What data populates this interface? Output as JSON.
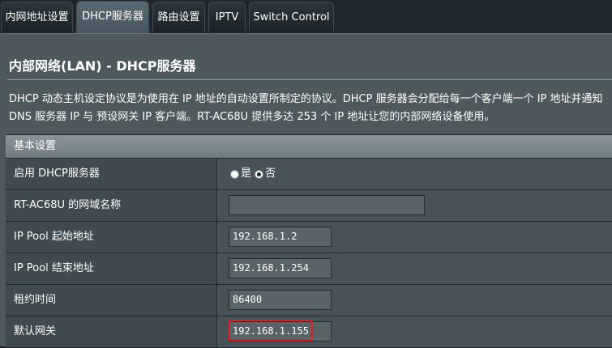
{
  "tabs": [
    {
      "label": "内网地址设置",
      "active": false
    },
    {
      "label": "DHCP服务器",
      "active": true
    },
    {
      "label": "路由设置",
      "active": false
    },
    {
      "label": "IPTV",
      "active": false
    },
    {
      "label": "Switch Control",
      "active": false
    }
  ],
  "page": {
    "title": "内部网络(LAN) - DHCP服务器",
    "description_line1": "DHCP 动态主机设定协议是为使用在 IP 地址的自动设置所制定的协议。DHCP 服务器会分配给每一个客户端一个 IP 地址并通知",
    "description_line2": "DNS 服务器 IP 与 预设网关 IP 客户端。RT-AC68U 提供多达 253 个 IP 地址让您的内部网络设备使用。"
  },
  "section": {
    "header": "基本设置"
  },
  "fields": {
    "enable_dhcp": {
      "label": "启用 DHCP服务器",
      "option_yes": "是",
      "option_no": "否",
      "selected": "否"
    },
    "domain_name": {
      "label": "RT-AC68U 的网域名称",
      "value": ""
    },
    "pool_start": {
      "label": "IP Pool 起始地址",
      "value": "192.168.1.2"
    },
    "pool_end": {
      "label": "IP Pool 结束地址",
      "value": "192.168.1.254"
    },
    "lease_time": {
      "label": "租约时间",
      "value": "86400"
    },
    "gateway": {
      "label": "默认网关",
      "value": "192.168.1.155"
    }
  },
  "colors": {
    "highlight": "#e02020",
    "panel": "#4d595d",
    "background": "#1c2226"
  }
}
